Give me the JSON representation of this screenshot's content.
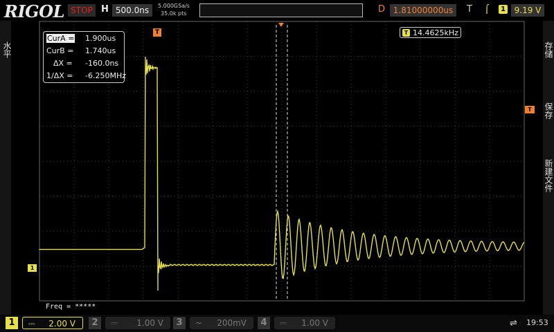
{
  "header": {
    "logo": "RIGOL",
    "run_status": "STOP",
    "timebase_label": "H",
    "timebase_value": "500.0ns",
    "sample_rate": "5.000GSa/s",
    "memory_depth": "35.0k pts",
    "delay_label": "D",
    "delay_value": "1.81000000us",
    "trigger_label": "T",
    "trigger_source": "1",
    "trigger_level": "9.19 V"
  },
  "side": {
    "left_menu": "水平",
    "right_menu": [
      "存储",
      "保存",
      "新建文件"
    ]
  },
  "cursors": {
    "cura_label": "CurA =",
    "cura_value": "1.900us",
    "curb_label": "CurB =",
    "curb_value": "1.740us",
    "dx_label": "ΔX =",
    "dx_value": "-160.0ns",
    "inv_dx_label": "1/ΔX =",
    "inv_dx_value": "-6.250MHz"
  },
  "trigger_freq": {
    "badge": "T",
    "value": "14.4625kHz"
  },
  "markers": {
    "channel1": "1",
    "trigger_pos": "T",
    "trigger_level": "T"
  },
  "measurement": "Freq = *****",
  "channels": [
    {
      "num": "1",
      "coupling": "⎓",
      "scale": "2.00 V",
      "active": true
    },
    {
      "num": "2",
      "coupling": "⎓",
      "scale": "1.00 V",
      "active": false
    },
    {
      "num": "3",
      "coupling": "~",
      "scale": "200mV",
      "active": false
    },
    {
      "num": "4",
      "coupling": "⎓",
      "scale": "1.00 V",
      "active": false
    }
  ],
  "status": {
    "usb_icon": "usb-icon",
    "time": "19:53"
  },
  "colors": {
    "ch1": "#e6e04a",
    "trigger": "#f08030",
    "stop": "#e02020"
  }
}
